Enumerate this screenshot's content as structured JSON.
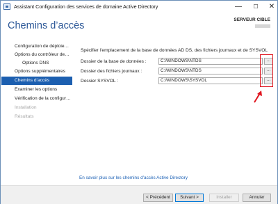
{
  "window": {
    "title": "Assistant Configuration des services de domaine Active Directory",
    "minimize_glyph": "—",
    "maximize_glyph": "☐",
    "close_glyph": "✕"
  },
  "header": {
    "page_title": "Chemins d’accès",
    "server_label": "SERVEUR CIBLE"
  },
  "sidebar": {
    "items": [
      {
        "label": "Configuration de déploie…",
        "state": "normal"
      },
      {
        "label": "Options du contrôleur de…",
        "state": "normal"
      },
      {
        "label": "Options DNS",
        "state": "normal"
      },
      {
        "label": "Options supplémentaires",
        "state": "normal"
      },
      {
        "label": "Chemins d’accès",
        "state": "active"
      },
      {
        "label": "Examiner les options",
        "state": "normal"
      },
      {
        "label": "Vérification de la configur…",
        "state": "normal"
      },
      {
        "label": "Installation",
        "state": "disabled"
      },
      {
        "label": "Résultats",
        "state": "disabled"
      }
    ]
  },
  "main": {
    "instruction": "Spécifier l’emplacement de la base de données AD DS, des fichiers journaux et de SYSVOL",
    "fields": [
      {
        "label": "Dossier de la base de données :",
        "value": "C:\\WINDOWS\\NTDS",
        "browse_label": "..."
      },
      {
        "label": "Dossier des fichiers journaux :",
        "value": "C:\\WINDOWS\\NTDS",
        "browse_label": "..."
      },
      {
        "label": "Dossier SYSVOL :",
        "value": "C:\\WINDOWS\\SYSVOL",
        "browse_label": "..."
      }
    ],
    "help_link": "En savoir plus sur les chemins d’accès Active Directory"
  },
  "footer": {
    "previous": "< Précédent",
    "next": "Suivant >",
    "install": "Installer",
    "cancel": "Annuler"
  },
  "annotation": {
    "highlight_color": "#e0141e"
  },
  "colors": {
    "accent": "#1c5fb0",
    "title": "#2b5797",
    "link": "#1a5fb4"
  }
}
